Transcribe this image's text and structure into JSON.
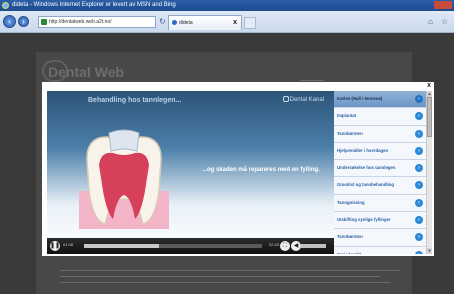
{
  "window": {
    "title": "dideta - Windows Internet Explorer er levert av MSN and Bing"
  },
  "browser": {
    "address": "http://dentalweb.web.a2t.no/",
    "tab_label": "dideta",
    "tab_close": "x",
    "new_tab": "",
    "back_icon": "back-arrow-icon",
    "forward_icon": "forward-arrow-icon"
  },
  "page": {
    "logo_text": "Dental Web"
  },
  "modal": {
    "close_label": "x",
    "video": {
      "title": "Behandling hos tannlegen...",
      "brand": "Dental Kanal",
      "caption": "...og skaden må repareres med en fylling.",
      "time_current": "01:08",
      "time_total": "02:43",
      "progress_fraction": 0.42
    },
    "sidebar": {
      "items": [
        {
          "label": "Karies (Hull i tennene)",
          "active": true
        },
        {
          "label": "Implantat",
          "active": false
        },
        {
          "label": "Tannbørsten",
          "active": false
        },
        {
          "label": "Hjelpemidler i hverdagen",
          "active": false
        },
        {
          "label": "Undersøkelse hos tannlegen",
          "active": false
        },
        {
          "label": "Grasitist og tannbehandling",
          "active": false
        },
        {
          "label": "Tanngnissing",
          "active": false
        },
        {
          "label": "Utskifting synlige fyllinger",
          "active": false
        },
        {
          "label": "Tannbørsten",
          "active": false
        },
        {
          "label": "Periodontitt",
          "active": false
        }
      ]
    }
  },
  "colors": {
    "accent": "#2e88d8",
    "active_item": "#8eb0d6"
  }
}
